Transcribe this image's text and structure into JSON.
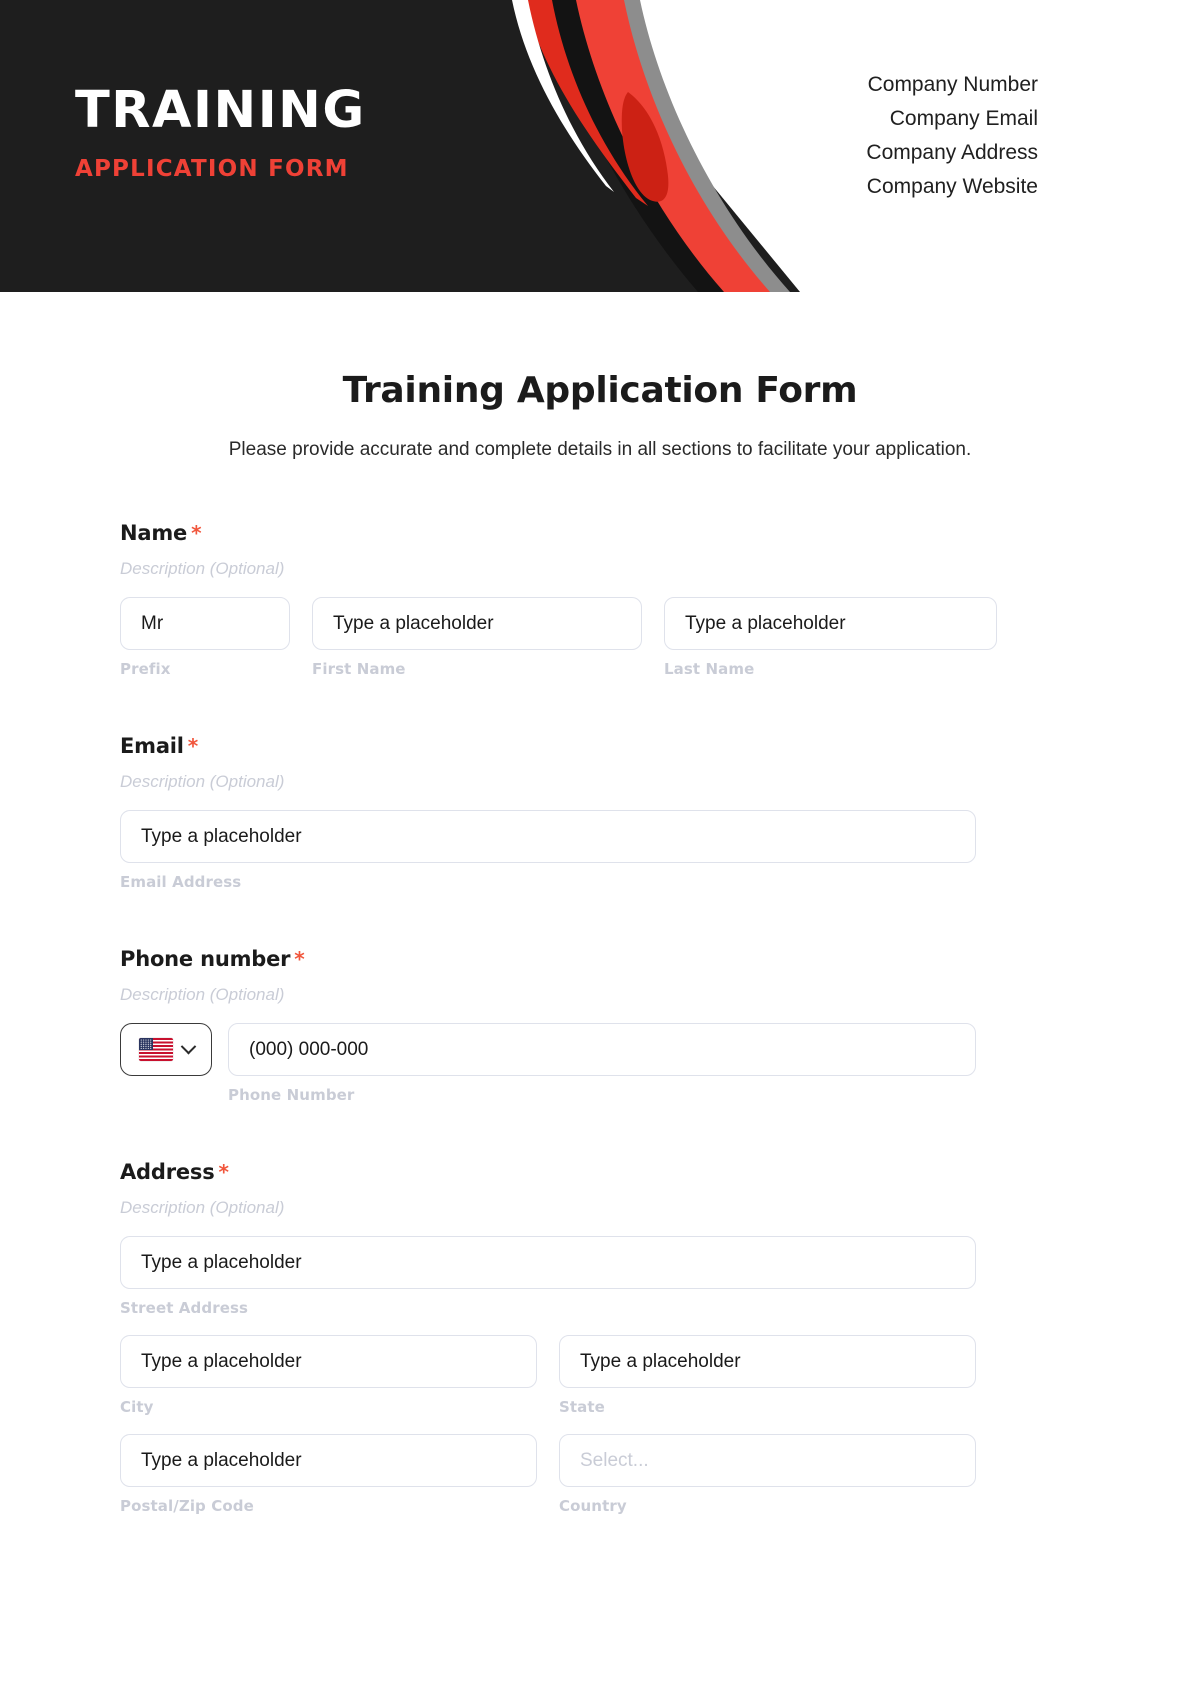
{
  "header": {
    "brand_title": "TRAINING",
    "brand_subtitle": "APPLICATION FORM",
    "company": [
      "Company Number",
      "Company Email",
      "Company Address",
      "Company Website"
    ],
    "colors": {
      "dark": "#1e1e1e",
      "accent_red": "#ef4136",
      "deep_red": "#cc2114",
      "gray_swoosh": "#8d8d8d"
    }
  },
  "form": {
    "title": "Training Application Form",
    "subtitle": "Please provide accurate and complete details in all sections to facilitate your application.",
    "description_placeholder": "Description (Optional)",
    "required_marker": "*",
    "sections": {
      "name": {
        "label": "Name",
        "description": "Description (Optional)",
        "prefix_value": "Mr",
        "prefix_sublabel": "Prefix",
        "first_value": "Type a placeholder",
        "first_sublabel": "First Name",
        "last_value": "Type a placeholder",
        "last_sublabel": "Last Name"
      },
      "email": {
        "label": "Email",
        "description": "Description (Optional)",
        "value": "Type a placeholder",
        "sublabel": "Email Address"
      },
      "phone": {
        "label": "Phone number",
        "description": "Description (Optional)",
        "country_flag": "us-flag-icon",
        "value": "(000) 000-000",
        "sublabel": "Phone Number"
      },
      "address": {
        "label": "Address",
        "description": "Description (Optional)",
        "street_value": "Type a placeholder",
        "street_sublabel": "Street Address",
        "city_value": "Type a placeholder",
        "city_sublabel": "City",
        "state_value": "Type a placeholder",
        "state_sublabel": "State",
        "postal_value": "Type a placeholder",
        "postal_sublabel": "Postal/Zip Code",
        "country_value": "Select...",
        "country_sublabel": "Country"
      }
    }
  }
}
